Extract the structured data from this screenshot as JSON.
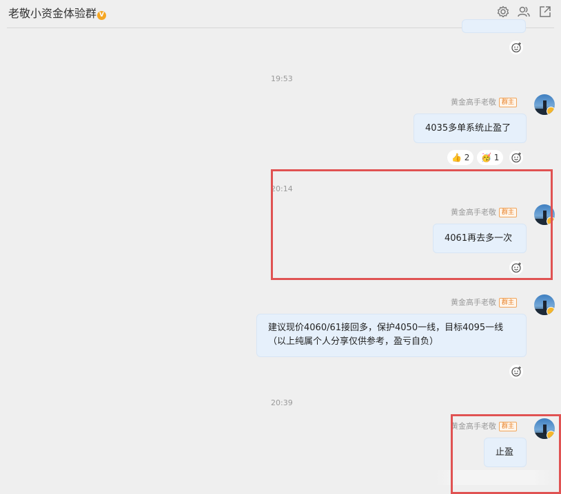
{
  "header": {
    "title": "老敬小资金体验群",
    "verified_mark": "V",
    "icons": [
      "gear-icon",
      "group-members-icon",
      "share-icon"
    ]
  },
  "messages": [
    {
      "time": "19:53",
      "sender": "黄金高手老敬",
      "role": "群主",
      "text": "4035多单系统止盈了",
      "reactions": [
        {
          "emoji": "👍",
          "count": "2"
        },
        {
          "emoji": "🥳",
          "count": "1"
        }
      ]
    },
    {
      "time": "20:14",
      "sender": "黄金高手老敬",
      "role": "群主",
      "text": "4061再去多一次"
    },
    {
      "sender": "黄金高手老敬",
      "role": "群主",
      "lines": [
        "建议现价4060/61接回多，保护4050一线，目标4095一线",
        "（以上纯属个人分享仅供参考，盈亏自负）"
      ]
    },
    {
      "time": "20:39",
      "sender": "黄金高手老敬",
      "role": "群主",
      "text": "止盈"
    }
  ],
  "colors": {
    "background": "#efefef",
    "bubble": "#e6f0fb",
    "highlight": "#e05252",
    "role_badge": "#e8822a"
  }
}
